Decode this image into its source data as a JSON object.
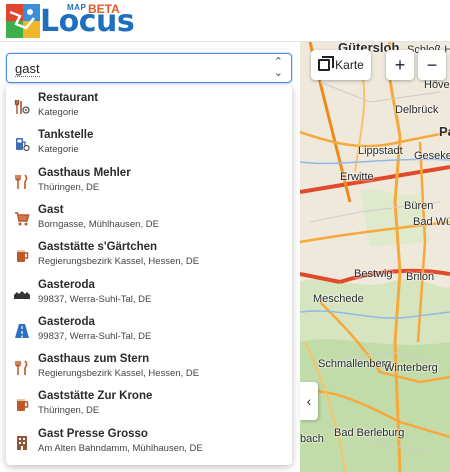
{
  "header": {
    "brand_small": "MAP",
    "brand_name": "Locus",
    "brand_badge": "BETA"
  },
  "search": {
    "value": "gast"
  },
  "map_controls": {
    "layer_label": "Karte",
    "zoom_in": "+",
    "zoom_out": "−",
    "collapse": "‹"
  },
  "map": {
    "labels": [
      "Gütersloh",
      "Schloß Holte",
      "Höve",
      "Delbrück",
      "Pa",
      "Lippstadt",
      "Geseke",
      "Erwitte",
      "Büren",
      "Bad Wü",
      "Bestwig",
      "Brilon",
      "Meschede",
      "Schmallenberg",
      "Winterberg",
      "Bad Berleburg",
      "bach"
    ]
  },
  "results": [
    {
      "title": "Restaurant",
      "subtitle": "Kategorie",
      "icon": "restaurant-category-icon",
      "color": "#9c4a25"
    },
    {
      "title": "Tankstelle",
      "subtitle": "Kategorie",
      "icon": "fuel-category-icon",
      "color": "#3f6fb0"
    },
    {
      "title": "Gasthaus Mehler",
      "subtitle": "Thüringen, DE",
      "icon": "fork-knife-icon",
      "color": "#c0572a"
    },
    {
      "title": "Gast",
      "subtitle": "Borngasse, Mühlhausen, DE",
      "icon": "shopping-cart-icon",
      "color": "#c0572a"
    },
    {
      "title": "Gaststätte s'Gärtchen",
      "subtitle": "Regierungsbezirk Kassel, Hessen, DE",
      "icon": "beer-mug-icon",
      "color": "#c0572a"
    },
    {
      "title": "Gasteroda",
      "subtitle": "99837, Werra-Suhl-Tal, DE",
      "icon": "village-icon",
      "color": "#333333"
    },
    {
      "title": "Gasteroda",
      "subtitle": "99837, Werra-Suhl-Tal, DE",
      "icon": "road-icon",
      "color": "#2f6fbf"
    },
    {
      "title": "Gasthaus zum Stern",
      "subtitle": "Regierungsbezirk Kassel, Hessen, DE",
      "icon": "fork-knife-icon",
      "color": "#c0572a"
    },
    {
      "title": "Gaststätte Zur Krone",
      "subtitle": "Thüringen, DE",
      "icon": "beer-mug-icon",
      "color": "#c0572a"
    },
    {
      "title": "Gast Presse Grosso",
      "subtitle": "Am Alten Bahndamm, Mühlhausen, DE",
      "icon": "building-icon",
      "color": "#8a5a3a"
    }
  ]
}
